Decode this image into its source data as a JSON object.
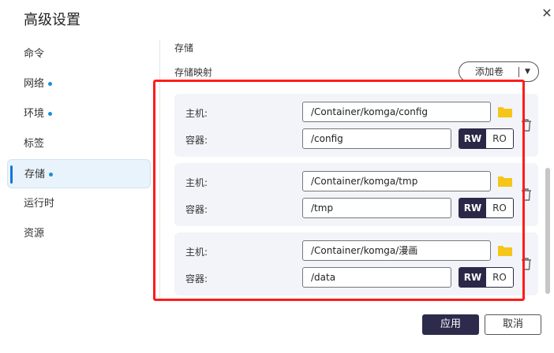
{
  "dialog": {
    "title": "高级设置",
    "close_icon": "close-icon"
  },
  "sidebar": {
    "items": [
      {
        "label": "命令",
        "dot": false,
        "active": false
      },
      {
        "label": "网络",
        "dot": true,
        "active": false
      },
      {
        "label": "环境",
        "dot": true,
        "active": false
      },
      {
        "label": "标签",
        "dot": false,
        "active": false
      },
      {
        "label": "存储",
        "dot": true,
        "active": true
      },
      {
        "label": "运行时",
        "dot": false,
        "active": false
      },
      {
        "label": "资源",
        "dot": false,
        "active": false
      }
    ],
    "dot_color": "#1a8fd6"
  },
  "main": {
    "section_title": "存储",
    "sub_title": "存储映射",
    "add_volume_label": "添加卷",
    "host_label": "主机:",
    "container_label": "容器:",
    "rw_label": "RW",
    "ro_label": "RO",
    "volumes": [
      {
        "host": "/Container/komga/config",
        "container": "/config",
        "mode": "RW"
      },
      {
        "host": "/Container/komga/tmp",
        "container": "/tmp",
        "mode": "RW"
      },
      {
        "host": "/Container/komga/漫画",
        "container": "/data",
        "mode": "RW"
      }
    ]
  },
  "footer": {
    "apply_label": "应用",
    "cancel_label": "取消"
  },
  "colors": {
    "accent": "#2c2b4b",
    "highlight_border": "#ff1b1b",
    "folder": "#f5c518"
  }
}
